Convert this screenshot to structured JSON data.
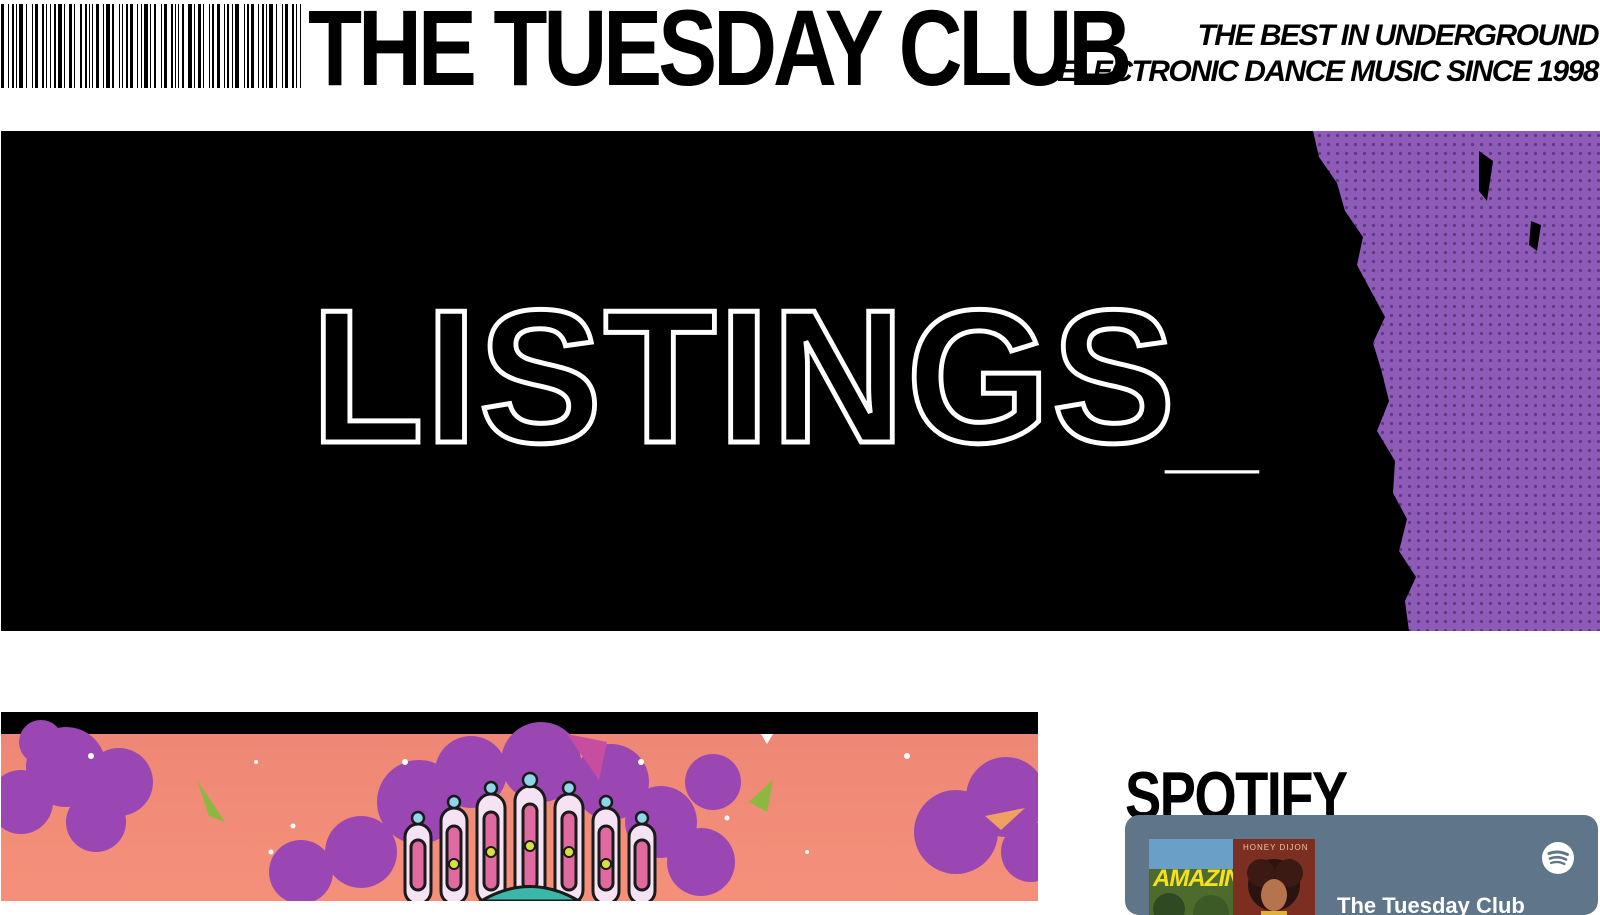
{
  "header": {
    "logo_text": "THE TUESDAY CLUB",
    "tagline_line1": "THE BEST IN UNDERGROUND",
    "tagline_line2": "ELECTRONIC DANCE MUSIC SINCE 1998"
  },
  "hero": {
    "title": "LISTINGS",
    "cursor": "_"
  },
  "spotify": {
    "heading": "SPOTIFY",
    "cover1_text": "AMAZING",
    "cover2_text": "HONEY DIJON",
    "playlist_title": "The Tuesday Club"
  },
  "colors": {
    "hero_background": "#000000",
    "halftone_purple": "#8e5bb8",
    "ad_pink": "#ee8876",
    "ad_purple": "#9b47b3",
    "spotify_embed": "#5f7589"
  },
  "icons": {
    "logo_barcode": "barcode-icon",
    "spotify_logo": "spotify-icon"
  }
}
